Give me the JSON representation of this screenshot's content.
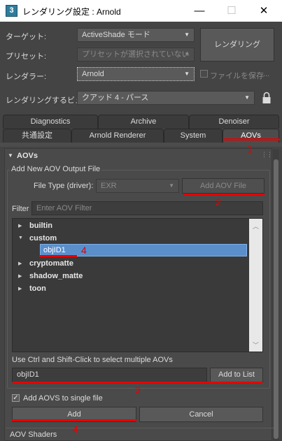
{
  "window": {
    "app_icon": "3",
    "title": "レンダリング設定 : Arnold",
    "minimize": "—",
    "maximize": "☐",
    "close": "✕"
  },
  "header": {
    "target_label": "ターゲット:",
    "target_value": "ActiveShade モード",
    "preset_label": "プリセット:",
    "preset_value": "プリセットが選択されていない",
    "renderer_label": "レンダラー:",
    "renderer_value": "Arnold",
    "save_file_label": "ファイルを保存",
    "more": "...",
    "render_button": "レンダリング",
    "view_label": "レンダリングするビュー:",
    "view_value": "クアッド 4 - パース",
    "lock_icon": "lock-icon"
  },
  "tabs": {
    "row1": [
      "Diagnostics",
      "Archive",
      "Denoiser"
    ],
    "row2": [
      "共通設定",
      "Arnold Renderer",
      "System",
      "AOVs"
    ],
    "active": "AOVs"
  },
  "aovs": {
    "section_title": "AOVs",
    "group_title": "Add New AOV Output File",
    "file_type_label": "File Type (driver):",
    "file_type_value": "EXR",
    "add_aov_file_button": "Add AOV File",
    "filter_label": "Filter",
    "filter_placeholder": "Enter AOV Filter",
    "tree": [
      {
        "label": "builtin",
        "expanded": false
      },
      {
        "label": "custom",
        "expanded": true
      },
      {
        "label": "objID1",
        "child": true,
        "selected": true
      },
      {
        "label": "cryptomatte",
        "expanded": false
      },
      {
        "label": "shadow_matte",
        "expanded": false
      },
      {
        "label": "toon",
        "expanded": false
      }
    ],
    "hint": "Use Ctrl and Shift-Click to select multiple AOVs",
    "name_value": "objID1",
    "add_to_list_button": "Add to List",
    "single_file_label": "Add AOVS to single file",
    "single_file_checked": true,
    "add_button": "Add",
    "cancel_button": "Cancel",
    "next_section": "AOV Shaders"
  },
  "annotations": [
    "1",
    "2",
    "3",
    "4",
    "4"
  ],
  "colors": {
    "highlight": "#e40000",
    "selection": "#5b8fcc"
  }
}
